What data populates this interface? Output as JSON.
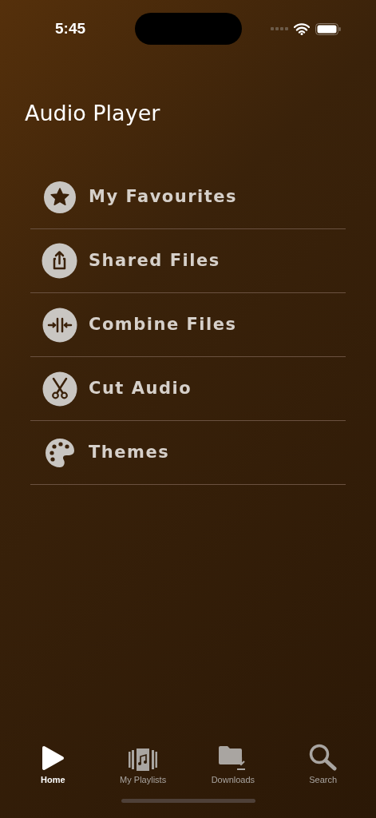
{
  "status_bar": {
    "time": "5:45"
  },
  "title": "Audio Player",
  "menu": [
    {
      "kind": "star",
      "label": "My Favourites"
    },
    {
      "kind": "share",
      "label": "Shared Files"
    },
    {
      "kind": "combine",
      "label": "Combine Files"
    },
    {
      "kind": "scissors",
      "label": "Cut Audio"
    },
    {
      "kind": "palette",
      "label": "Themes"
    }
  ],
  "tabs": [
    {
      "kind": "play",
      "label": "Home",
      "selected": true
    },
    {
      "kind": "playlist",
      "label": "My Playlists",
      "selected": false
    },
    {
      "kind": "download",
      "label": "Downloads",
      "selected": false
    },
    {
      "kind": "search",
      "label": "Search",
      "selected": false
    }
  ]
}
